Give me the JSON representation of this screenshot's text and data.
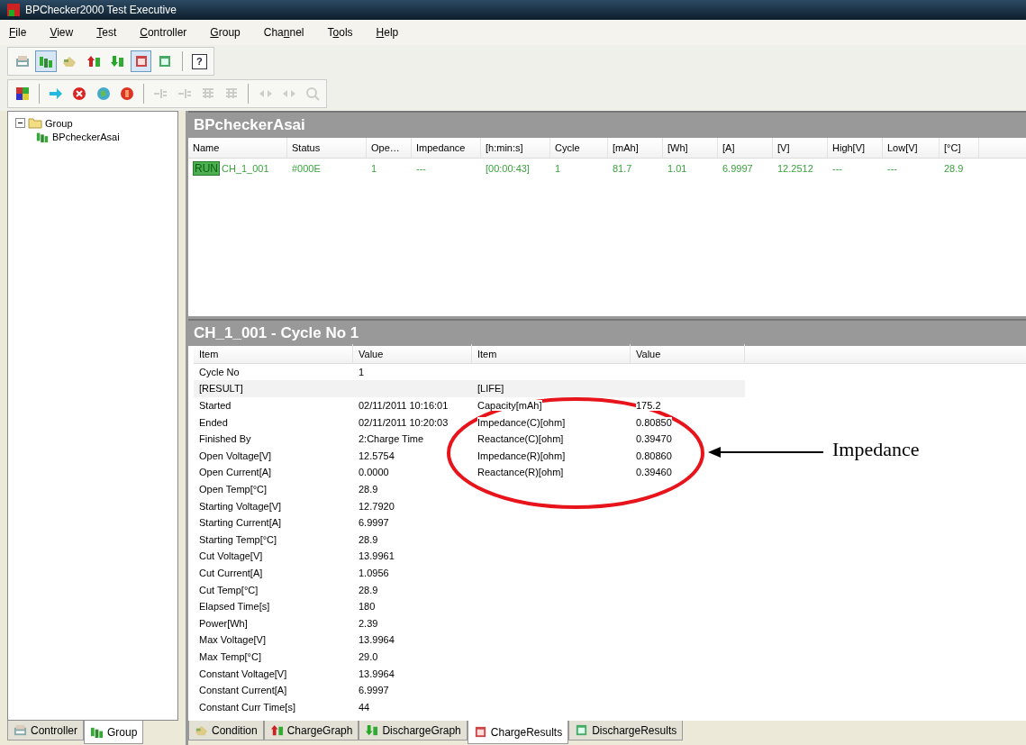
{
  "window": {
    "title": "BPChecker2000 Test Executive"
  },
  "menu": [
    {
      "label": "File"
    },
    {
      "label": "View"
    },
    {
      "label": "Test"
    },
    {
      "label": "Controller"
    },
    {
      "label": "Group"
    },
    {
      "label": "Channel"
    },
    {
      "label": "Tools"
    },
    {
      "label": "Help"
    }
  ],
  "toolbar_1": [
    {
      "pressed": false
    },
    {
      "pressed": true
    },
    {
      "pressed": false
    },
    {
      "pressed": false
    },
    {
      "pressed": false
    },
    {
      "pressed": true
    },
    {
      "pressed": false
    },
    {
      "pressed": false,
      "glyph": "?"
    }
  ],
  "toolbar_2": [
    {
      "disabled": false
    },
    {
      "disabled": false
    },
    {
      "disabled": false
    },
    {
      "disabled": false
    },
    {
      "disabled": false
    },
    {
      "disabled": true
    },
    {
      "disabled": true
    },
    {
      "disabled": true
    },
    {
      "disabled": true
    },
    {
      "disabled": true
    },
    {
      "disabled": true
    },
    {
      "disabled": true
    }
  ],
  "tree": [
    {
      "label": "Group",
      "expanded": true,
      "children": [
        {
          "label": "BPcheckerAsai"
        }
      ]
    }
  ],
  "left_tabs": [
    {
      "label": "Controller",
      "selected": false
    },
    {
      "label": "Group",
      "selected": true
    }
  ],
  "channel_grid": {
    "title": "BPcheckerAsai",
    "columns": [
      "Name",
      "Status",
      "Ope…",
      "Impedance",
      "[h:min:s]",
      "Cycle",
      "[mAh]",
      "[Wh]",
      "[A]",
      "[V]",
      "High[V]",
      "Low[V]",
      "[°C]"
    ],
    "rows": [
      {
        "badge": "RUN",
        "cells": [
          "CH_1_001",
          "#000E",
          "1",
          "---",
          "[00:00:43]",
          "1",
          "81.7",
          "1.01",
          "6.9997",
          "12.2512",
          "---",
          "---",
          "28.9"
        ]
      }
    ]
  },
  "results": {
    "title": "CH_1_001 - Cycle No 1",
    "columns": [
      "Item",
      "Value",
      "Item",
      "Value"
    ],
    "rows": [
      {
        "kind": "data",
        "left": {
          "item": "Cycle No",
          "value": "1"
        }
      },
      {
        "kind": "section",
        "left": {
          "item": "[RESULT]"
        },
        "right": {
          "item": "[LIFE]"
        }
      },
      {
        "kind": "data",
        "left": {
          "item": "Started",
          "value": "02/11/2011 10:16:01"
        },
        "right": {
          "item": "Capacity[mAh]",
          "value": "175.2"
        }
      },
      {
        "kind": "data",
        "left": {
          "item": "Ended",
          "value": "02/11/2011 10:20:03"
        },
        "right": {
          "item": "Impedance(C)[ohm]",
          "value": "0.80850"
        }
      },
      {
        "kind": "data",
        "left": {
          "item": "Finished By",
          "value": "2:Charge Time"
        },
        "right": {
          "item": "Reactance(C)[ohm]",
          "value": "0.39470"
        }
      },
      {
        "kind": "data",
        "left": {
          "item": "Open Voltage[V]",
          "value": "12.5754"
        },
        "right": {
          "item": "Impedance(R)[ohm]",
          "value": "0.80860"
        }
      },
      {
        "kind": "data",
        "left": {
          "item": "Open Current[A]",
          "value": "0.0000"
        },
        "right": {
          "item": "Reactance(R)[ohm]",
          "value": "0.39460"
        }
      },
      {
        "kind": "data",
        "left": {
          "item": "Open Temp[°C]",
          "value": "28.9"
        }
      },
      {
        "kind": "data",
        "left": {
          "item": "Starting Voltage[V]",
          "value": "12.7920"
        }
      },
      {
        "kind": "data",
        "left": {
          "item": "Starting Current[A]",
          "value": "6.9997"
        }
      },
      {
        "kind": "data",
        "left": {
          "item": "Starting Temp[°C]",
          "value": "28.9"
        }
      },
      {
        "kind": "data",
        "left": {
          "item": "Cut Voltage[V]",
          "value": "13.9961"
        }
      },
      {
        "kind": "data",
        "left": {
          "item": "Cut Current[A]",
          "value": "1.0956"
        }
      },
      {
        "kind": "data",
        "left": {
          "item": "Cut Temp[°C]",
          "value": "28.9"
        }
      },
      {
        "kind": "data",
        "left": {
          "item": "Elapsed Time[s]",
          "value": "180"
        }
      },
      {
        "kind": "data",
        "left": {
          "item": "Power[Wh]",
          "value": "2.39"
        }
      },
      {
        "kind": "data",
        "left": {
          "item": "Max Voltage[V]",
          "value": "13.9964"
        }
      },
      {
        "kind": "data",
        "left": {
          "item": "Max Temp[°C]",
          "value": "29.0"
        }
      },
      {
        "kind": "data",
        "left": {
          "item": "Constant Voltage[V]",
          "value": "13.9964"
        }
      },
      {
        "kind": "data",
        "left": {
          "item": "Constant Current[A]",
          "value": "6.9997"
        }
      },
      {
        "kind": "data",
        "left": {
          "item": "Constant Curr Time[s]",
          "value": "44"
        }
      }
    ]
  },
  "bottom_tabs": [
    {
      "label": "Condition",
      "selected": false
    },
    {
      "label": "ChargeGraph",
      "selected": false
    },
    {
      "label": "DischargeGraph",
      "selected": false
    },
    {
      "label": "ChargeResults",
      "selected": true
    },
    {
      "label": "DischargeResults",
      "selected": false
    }
  ],
  "annotation": {
    "label": "Impedance"
  }
}
